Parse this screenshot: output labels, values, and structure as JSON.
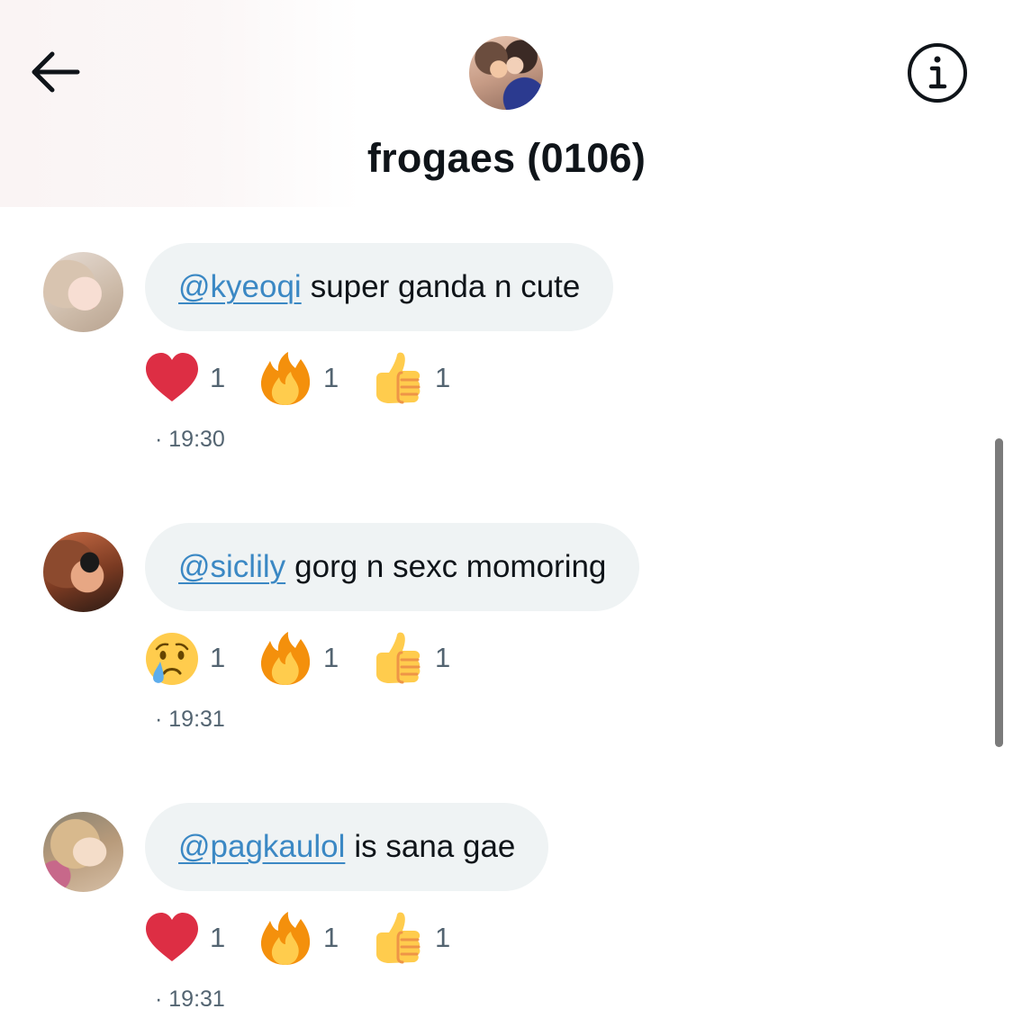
{
  "header": {
    "title": "frogaes (0106)",
    "back_icon": "arrow-left-icon",
    "info_icon": "info-icon"
  },
  "messages": [
    {
      "mention": "@kyeoqi",
      "text": "super ganda n cute",
      "time": "· 19:30",
      "reactions": [
        {
          "emoji": "heart",
          "count": "1"
        },
        {
          "emoji": "fire",
          "count": "1"
        },
        {
          "emoji": "thumbs-up",
          "count": "1"
        }
      ]
    },
    {
      "mention": "@siclily",
      "text": "gorg n sexc momoring",
      "time": "· 19:31",
      "reactions": [
        {
          "emoji": "crying-face",
          "count": "1"
        },
        {
          "emoji": "fire",
          "count": "1"
        },
        {
          "emoji": "thumbs-up",
          "count": "1"
        }
      ]
    },
    {
      "mention": "@pagkaulol",
      "text": "is sana gae",
      "time": "· 19:31",
      "reactions": [
        {
          "emoji": "heart",
          "count": "1"
        },
        {
          "emoji": "fire",
          "count": "1"
        },
        {
          "emoji": "thumbs-up",
          "count": "1"
        }
      ]
    }
  ],
  "colors": {
    "mention": "#3b88c4",
    "bubble": "#eff3f4",
    "secondary_text": "#536471",
    "primary_text": "#0f1419"
  }
}
